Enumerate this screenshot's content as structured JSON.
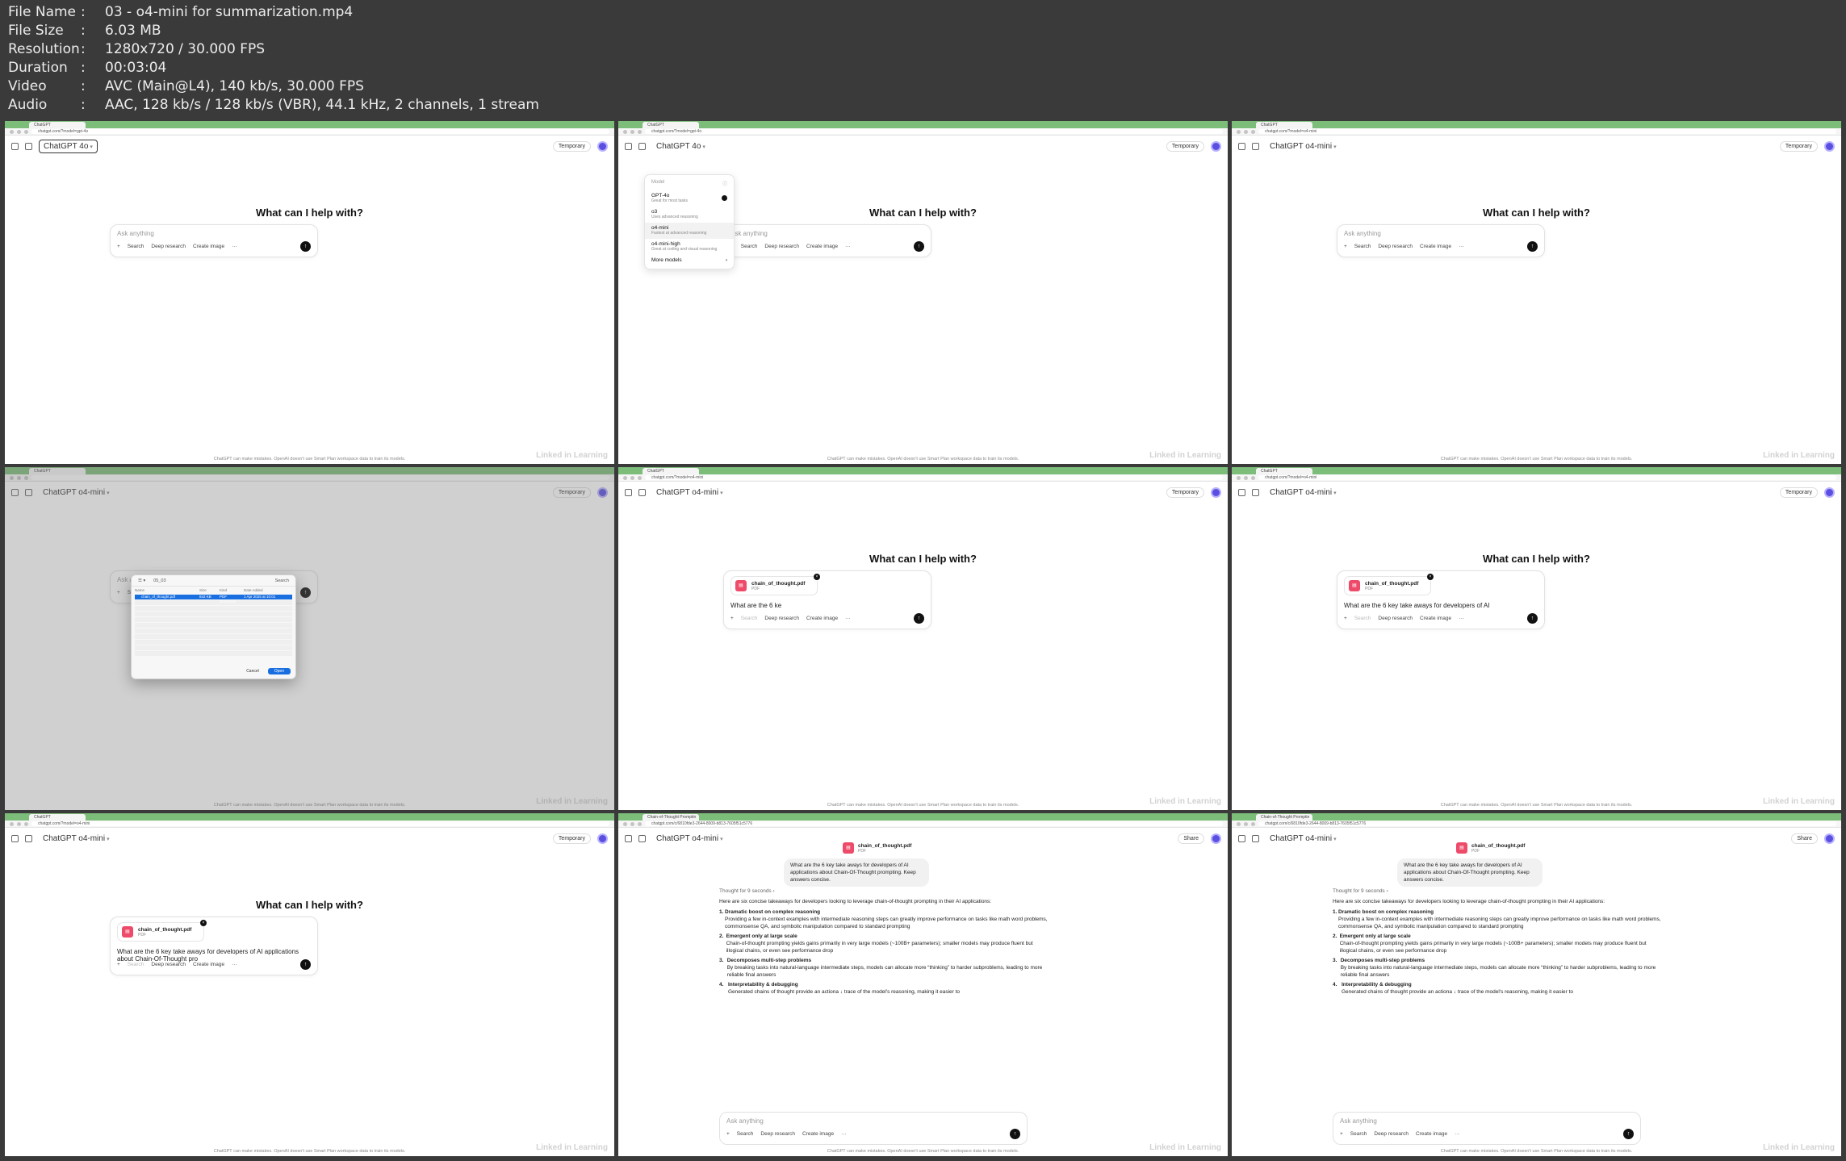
{
  "meta": {
    "rows": [
      {
        "key": "File Name",
        "value": "03 - o4-mini for summarization.mp4"
      },
      {
        "key": "File Size",
        "value": "6.03 MB"
      },
      {
        "key": "Resolution",
        "value": "1280x720 / 30.000 FPS"
      },
      {
        "key": "Duration",
        "value": "00:03:04"
      },
      {
        "key": "Video",
        "value": "AVC (Main@L4), 140 kb/s, 30.000 FPS"
      },
      {
        "key": "Audio",
        "value": "AAC, 128 kb/s / 128 kb/s (VBR), 44.1 kHz, 2 channels, 1 stream"
      }
    ],
    "separator": ":"
  },
  "common": {
    "tab_title": "ChatGPT",
    "hero": "What can I help with?",
    "placeholder": "Ask anything",
    "tools": {
      "search": "Search",
      "deep_research": "Deep research",
      "create_image": "Create image",
      "more": "···"
    },
    "temporary": "Temporary",
    "share": "Share",
    "footer": "ChatGPT can make mistakes. OpenAI doesn't use Smart Plan workspace data to train its models.",
    "watermark": "Linked in Learning",
    "file_name": "chain_of_thought.pdf",
    "file_type": "PDF"
  },
  "frames": [
    {
      "url": "chatgpt.com/?model=gpt-4o",
      "model": "ChatGPT 4o"
    },
    {
      "url": "chatgpt.com/?model=gpt-4o",
      "model": "ChatGPT 4o"
    },
    {
      "url": "chatgpt.com/?model=o4-mini",
      "model": "ChatGPT o4-mini"
    },
    {
      "url": "",
      "model": "ChatGPT o4-mini"
    },
    {
      "url": "chatgpt.com/?model=o4-mini",
      "model": "ChatGPT o4-mini",
      "typed": "What are the 6 ke"
    },
    {
      "url": "chatgpt.com/?model=o4-mini",
      "model": "ChatGPT o4-mini",
      "typed": "What are the 6 key take aways for developers of AI"
    },
    {
      "url": "chatgpt.com/?model=o4-mini",
      "model": "ChatGPT o4-mini",
      "typed": "What are the 6 key take aways for developers of AI applications about Chain-Of-Thought pro"
    },
    {
      "url": "chatgpt.com/c/6810fde3-2644-8009-b813-7605f51c5776",
      "model": "ChatGPT o4-mini",
      "tab": "Chain-of-Thought Promptin"
    },
    {
      "url": "chatgpt.com/c/6810fde3-2644-8009-b813-7605f51c5776",
      "model": "ChatGPT o4-mini",
      "tab": "Chain-of-Thought Promptin"
    }
  ],
  "dropdown": {
    "header": "Model",
    "items": [
      {
        "title": "GPT-4o",
        "sub": "Great for most tasks"
      },
      {
        "title": "o3",
        "sub": "Uses advanced reasoning"
      },
      {
        "title": "o4-mini",
        "sub": "Fastest at advanced reasoning"
      },
      {
        "title": "o4-mini-high",
        "sub": "Great at coding and visual reasoning"
      }
    ],
    "more": "More models"
  },
  "dialog": {
    "folder": "05_03",
    "search": "Search",
    "columns": [
      "Name",
      "Size",
      "Kind",
      "Date Added"
    ],
    "selected": {
      "name": "chain_of_thought.pdf",
      "size": "842 KB",
      "kind": "PDF Document",
      "date": "1 Apr 2025 at 10:01"
    },
    "cancel": "Cancel",
    "open": "Open"
  },
  "chat": {
    "question": "What are the 6 key take aways for developers of AI applications about Chain-Of-Thought prompting.  Keep answers concise.",
    "thought": "Thought for 9 seconds  ›",
    "intro": "Here are six concise takeaways for developers looking to leverage chain-of-thought prompting in their AI applications:",
    "items": [
      {
        "num": "1.",
        "title": "Dramatic boost on complex reasoning",
        "body": "Providing a few in-context examples with intermediate reasoning steps can greatly improve performance on tasks like math word problems, commonsense QA, and symbolic manipulation compared to standard prompting"
      },
      {
        "num": "2.",
        "title": "Emergent only at large scale",
        "body": "Chain-of-thought prompting yields gains primarily in very large models (~100B+ parameters); smaller models may produce fluent but illogical chains, or even see performance drop"
      },
      {
        "num": "3.",
        "title": "Decomposes multi-step problems",
        "body": "By breaking tasks into natural-language intermediate steps, models can allocate more “thinking” to harder subproblems, leading to more reliable final answers"
      },
      {
        "num": "4.",
        "title": "Interpretability & debugging",
        "body": "Generated chains of thought provide an actiona ↓ trace of the model's reasoning, making it easier to"
      }
    ]
  }
}
